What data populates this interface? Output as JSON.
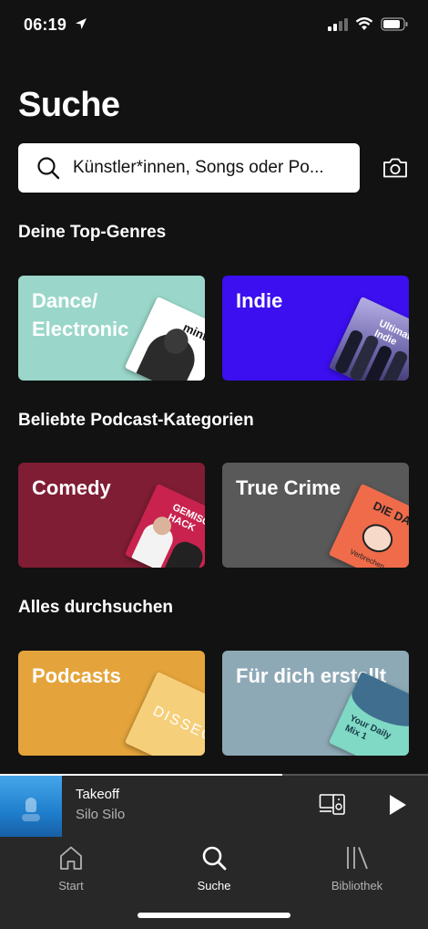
{
  "status_bar": {
    "time": "06:19"
  },
  "header": {
    "title": "Suche"
  },
  "search": {
    "placeholder": "Künstler*innen, Songs oder Po..."
  },
  "sections": {
    "top_genres": {
      "title": "Deine Top-Genres",
      "tiles": [
        {
          "label": "Dance/ Electronic",
          "color": "#9ad7ca",
          "art_text": "mint"
        },
        {
          "label": "Indie",
          "color": "#3b0fef",
          "art_text": "Ultimate Indie"
        }
      ]
    },
    "podcast_categories": {
      "title": "Beliebte Podcast-Kategorien",
      "tiles": [
        {
          "label": "Comedy",
          "color": "#7f1d34",
          "art_text": "GEMISCHTES HACK"
        },
        {
          "label": "True Crime",
          "color": "#595959",
          "art_text": "DIE DA",
          "art_subtext": "Verbrechen"
        }
      ]
    },
    "browse_all": {
      "title": "Alles durchsuchen",
      "tiles": [
        {
          "label": "Podcasts",
          "color": "#e5a43b",
          "art_text": "DISSEC"
        },
        {
          "label": "Für dich erstellt",
          "color": "#8ea9b6",
          "art_text": "Your Daily Mix 1"
        }
      ]
    }
  },
  "now_playing": {
    "title": "Takeoff",
    "artist": "Silo Silo",
    "progress": 0.66
  },
  "tab_bar": {
    "items": [
      {
        "label": "Start",
        "icon": "home-icon",
        "active": false
      },
      {
        "label": "Suche",
        "icon": "search-icon",
        "active": true
      },
      {
        "label": "Bibliothek",
        "icon": "library-icon",
        "active": false
      }
    ]
  },
  "colors": {
    "background": "#121212",
    "player_bg": "#282828",
    "secondary_text": "#b3b3b3"
  }
}
